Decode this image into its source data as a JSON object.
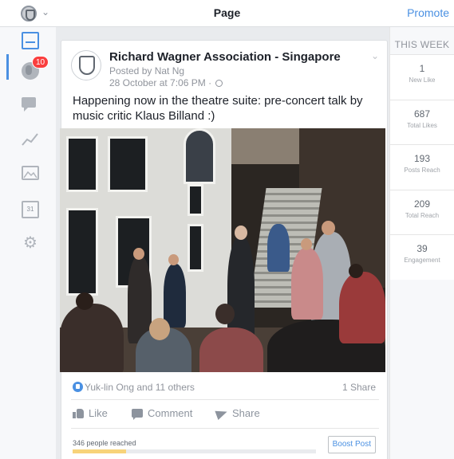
{
  "header": {
    "title": "Page",
    "promote_label": "Promote"
  },
  "sidebar": {
    "notification_count": "10",
    "calendar_day": "31"
  },
  "post": {
    "author": "Richard Wagner Association - Singapore",
    "posted_by": "Posted by Nat Ng",
    "timestamp": "28 October at 7:06 PM ·",
    "text": "Happening now in the theatre suite: pre-concert talk by music critic Klaus Billand :)",
    "reactions_text": "Yuk-lin Ong and 11 others",
    "shares_text": "1 Share",
    "like_label": "Like",
    "comment_label": "Comment",
    "share_label": "Share",
    "reached_text": "346 people reached",
    "reach_progress_fraction": 0.22,
    "boost_label": "Boost Post"
  },
  "stats": {
    "heading": "THIS WEEK",
    "items": [
      {
        "value": "1",
        "label": "New Like"
      },
      {
        "value": "687",
        "label": "Total Likes"
      },
      {
        "value": "193",
        "label": "Posts Reach"
      },
      {
        "value": "209",
        "label": "Total Reach"
      },
      {
        "value": "39",
        "label": "Engagement"
      }
    ]
  },
  "colors": {
    "accent": "#4a90e2",
    "badge": "#fa3e3e",
    "progress": "#f7d37a"
  }
}
